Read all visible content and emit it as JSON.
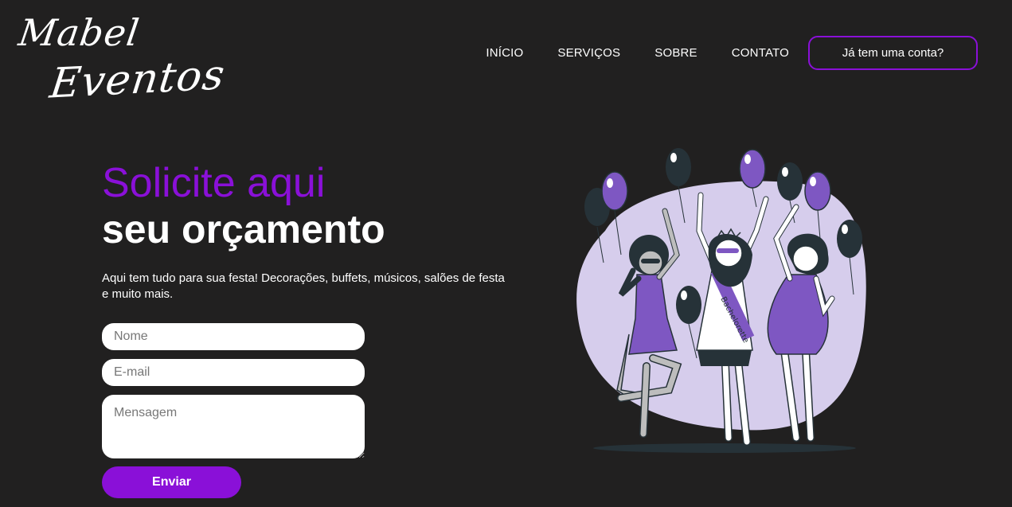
{
  "brand": {
    "logo_line1": "Mabel",
    "logo_line2": "Eventos"
  },
  "nav": {
    "items": [
      {
        "label": "INÍCIO"
      },
      {
        "label": "SERVIÇOS"
      },
      {
        "label": "SOBRE"
      },
      {
        "label": "CONTATO"
      }
    ],
    "account_label": "Já tem uma conta?"
  },
  "hero": {
    "title": "Solicite aqui",
    "subtitle": "seu orçamento",
    "description": "Aqui tem tudo para sua festa! Decorações, buffets, músicos, salões de festa e muito mais."
  },
  "form": {
    "name_placeholder": "Nome",
    "email_placeholder": "E-mail",
    "message_placeholder": "Mensagem",
    "submit_label": "Enviar"
  },
  "illustration": {
    "sash_text": "Bachelorette"
  },
  "colors": {
    "background": "#212020",
    "accent": "#8a10d8",
    "blob": "#d6cdec",
    "dress": "#7e57c2",
    "balloon_dark": "#263238"
  }
}
